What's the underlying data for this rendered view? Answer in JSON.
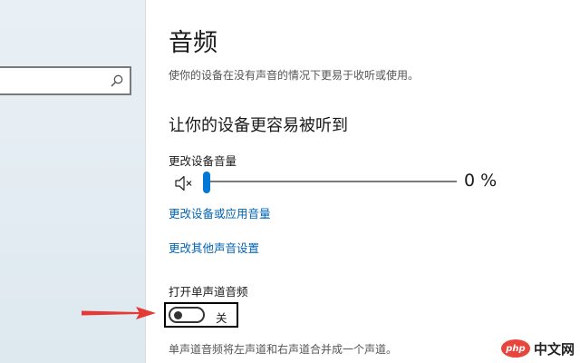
{
  "page": {
    "title": "音频",
    "description": "使你的设备在没有声音的情况下更易于收听或使用。"
  },
  "hearing": {
    "heading": "让你的设备更容易被听到",
    "volume_label": "更改设备音量",
    "volume_value_text": "0 %",
    "volume_percent": 0,
    "volume_icon": "speaker-mute-icon",
    "link_app_volume": "更改设备或应用音量",
    "link_other_sound": "更改其他声音设置"
  },
  "mono": {
    "label": "打开单声道音频",
    "state_text": "关",
    "enabled": false,
    "description": "单声道音频将左声道和右声道合并成一个声道。"
  },
  "search": {
    "icon": "search-icon",
    "placeholder": ""
  },
  "watermark": {
    "logo_text": "php",
    "site_text": "中文网"
  },
  "colors": {
    "accent": "#0078d7",
    "link": "#0063b1",
    "annotation": "#e53935"
  }
}
